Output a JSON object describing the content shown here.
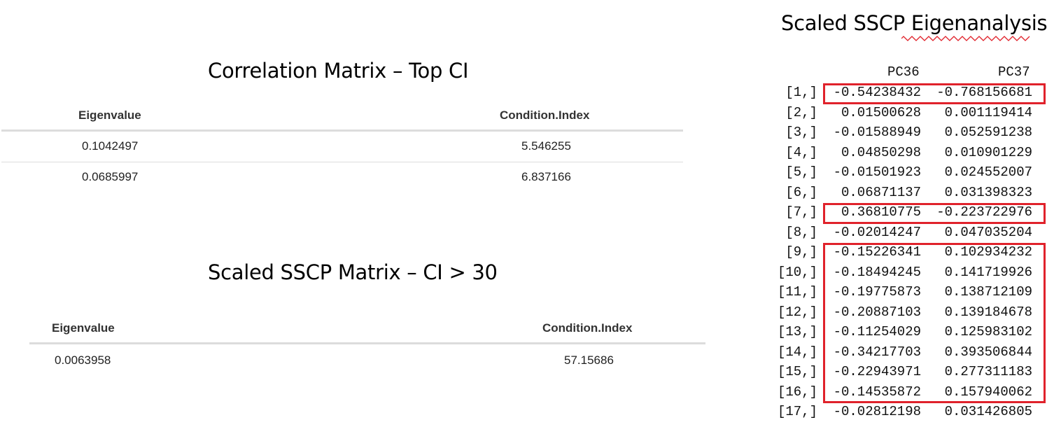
{
  "correlation": {
    "title": "Correlation Matrix – Top CI",
    "headers": [
      "Eigenvalue",
      "Condition.Index"
    ],
    "rows": [
      [
        "0.1042497",
        "5.546255"
      ],
      [
        "0.0685997",
        "6.837166"
      ]
    ]
  },
  "sscp_matrix": {
    "title": "Scaled SSCP Matrix – CI > 30",
    "headers": [
      "Eigenvalue",
      "Condition.Index"
    ],
    "rows": [
      [
        "0.0063958",
        "57.15686"
      ]
    ]
  },
  "eigen": {
    "title": "Scaled SSCP Eigenanalysis",
    "columns": [
      "PC36",
      "PC37"
    ],
    "rows": [
      {
        "label": "[1,]",
        "pc36": "-0.54238432",
        "pc37": "-0.768156681",
        "highlighted": true
      },
      {
        "label": "[2,]",
        "pc36": "0.01500628",
        "pc37": "0.001119414",
        "highlighted": false
      },
      {
        "label": "[3,]",
        "pc36": "-0.01588949",
        "pc37": "0.052591238",
        "highlighted": false
      },
      {
        "label": "[4,]",
        "pc36": "0.04850298",
        "pc37": "0.010901229",
        "highlighted": false
      },
      {
        "label": "[5,]",
        "pc36": "-0.01501923",
        "pc37": "0.024552007",
        "highlighted": false
      },
      {
        "label": "[6,]",
        "pc36": "0.06871137",
        "pc37": "0.031398323",
        "highlighted": false
      },
      {
        "label": "[7,]",
        "pc36": "0.36810775",
        "pc37": "-0.223722976",
        "highlighted": true
      },
      {
        "label": "[8,]",
        "pc36": "-0.02014247",
        "pc37": "0.047035204",
        "highlighted": false
      },
      {
        "label": "[9,]",
        "pc36": "-0.15226341",
        "pc37": "0.102934232",
        "highlighted": true
      },
      {
        "label": "[10,]",
        "pc36": "-0.18494245",
        "pc37": "0.141719926",
        "highlighted": true
      },
      {
        "label": "[11,]",
        "pc36": "-0.19775873",
        "pc37": "0.138712109",
        "highlighted": true
      },
      {
        "label": "[12,]",
        "pc36": "-0.20887103",
        "pc37": "0.139184678",
        "highlighted": true
      },
      {
        "label": "[13,]",
        "pc36": "-0.11254029",
        "pc37": "0.125983102",
        "highlighted": true
      },
      {
        "label": "[14,]",
        "pc36": "-0.34217703",
        "pc37": "0.393506844",
        "highlighted": true
      },
      {
        "label": "[15,]",
        "pc36": "-0.22943971",
        "pc37": "0.277311183",
        "highlighted": true
      },
      {
        "label": "[16,]",
        "pc36": "-0.14535872",
        "pc37": "0.157940062",
        "highlighted": true
      },
      {
        "label": "[17,]",
        "pc36": "-0.02812198",
        "pc37": "0.031426805",
        "highlighted": false
      }
    ],
    "highlight_color": "#e0222b"
  }
}
